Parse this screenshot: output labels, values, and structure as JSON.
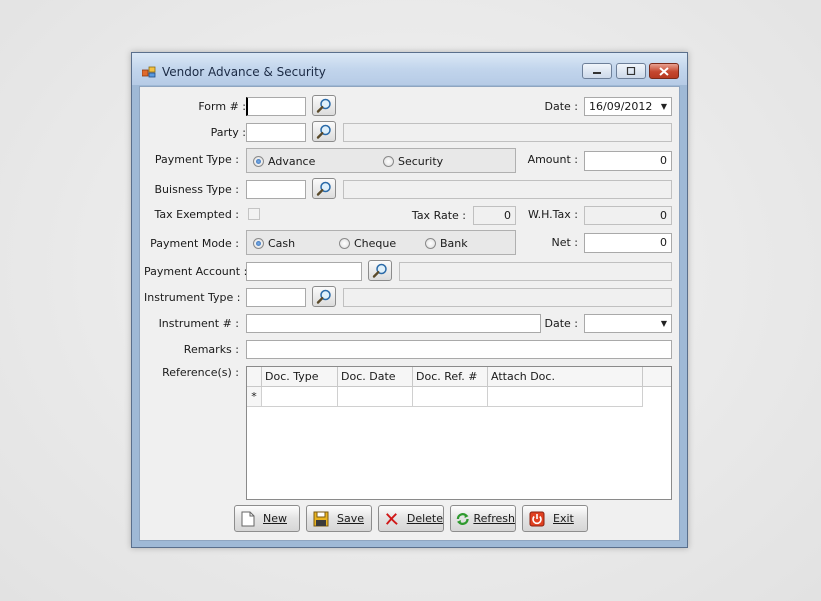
{
  "window": {
    "title": "Vendor Advance & Security"
  },
  "form": {
    "form_no_label": "Form # :",
    "form_no_value": "",
    "date_label": "Date :",
    "date_value": "16/09/2012",
    "party_label": "Party :",
    "party_value": "",
    "party_name": "",
    "payment_type_label": "Payment Type :",
    "payment_type_options": [
      "Advance",
      "Security"
    ],
    "payment_type_selected": "Advance",
    "amount_label": "Amount :",
    "amount_value": "0",
    "business_type_label": "Buisness Type :",
    "business_type_value": "",
    "business_type_name": "",
    "tax_exempted_label": "Tax Exempted :",
    "tax_rate_label": "Tax Rate :",
    "tax_rate_value": "0",
    "wh_tax_label": "W.H.Tax :",
    "wh_tax_value": "0",
    "payment_mode_label": "Payment Mode :",
    "payment_mode_options": [
      "Cash",
      "Cheque",
      "Bank"
    ],
    "payment_mode_selected": "Cash",
    "net_label": "Net :",
    "net_value": "0",
    "payment_account_label": "Payment Account :",
    "payment_account_value": "",
    "payment_account_name": "",
    "instrument_type_label": "Instrument Type :",
    "instrument_type_value": "",
    "instrument_type_name": "",
    "instrument_no_label": "Instrument # :",
    "instrument_no_value": "",
    "instrument_date_label": "Date :",
    "instrument_date_value": "",
    "remarks_label": "Remarks :",
    "remarks_value": "",
    "references_label": "Reference(s) :"
  },
  "grid": {
    "columns": [
      "Doc. Type",
      "Doc. Date",
      "Doc. Ref. #",
      "Attach Doc."
    ],
    "new_row_marker": "*"
  },
  "buttons": {
    "new": "New",
    "save": "Save",
    "delete": "Delete",
    "refresh": "Refresh",
    "exit": "Exit"
  },
  "icons": {
    "search": "magnifier-icon",
    "new": "document-icon",
    "save": "floppy-icon",
    "delete": "red-x-icon",
    "refresh": "green-arrows-icon",
    "exit": "power-icon"
  },
  "colors": {
    "title_bar": "#c2d5ec",
    "close_button": "#c5472f",
    "radio_selected": "#2c64b0"
  }
}
